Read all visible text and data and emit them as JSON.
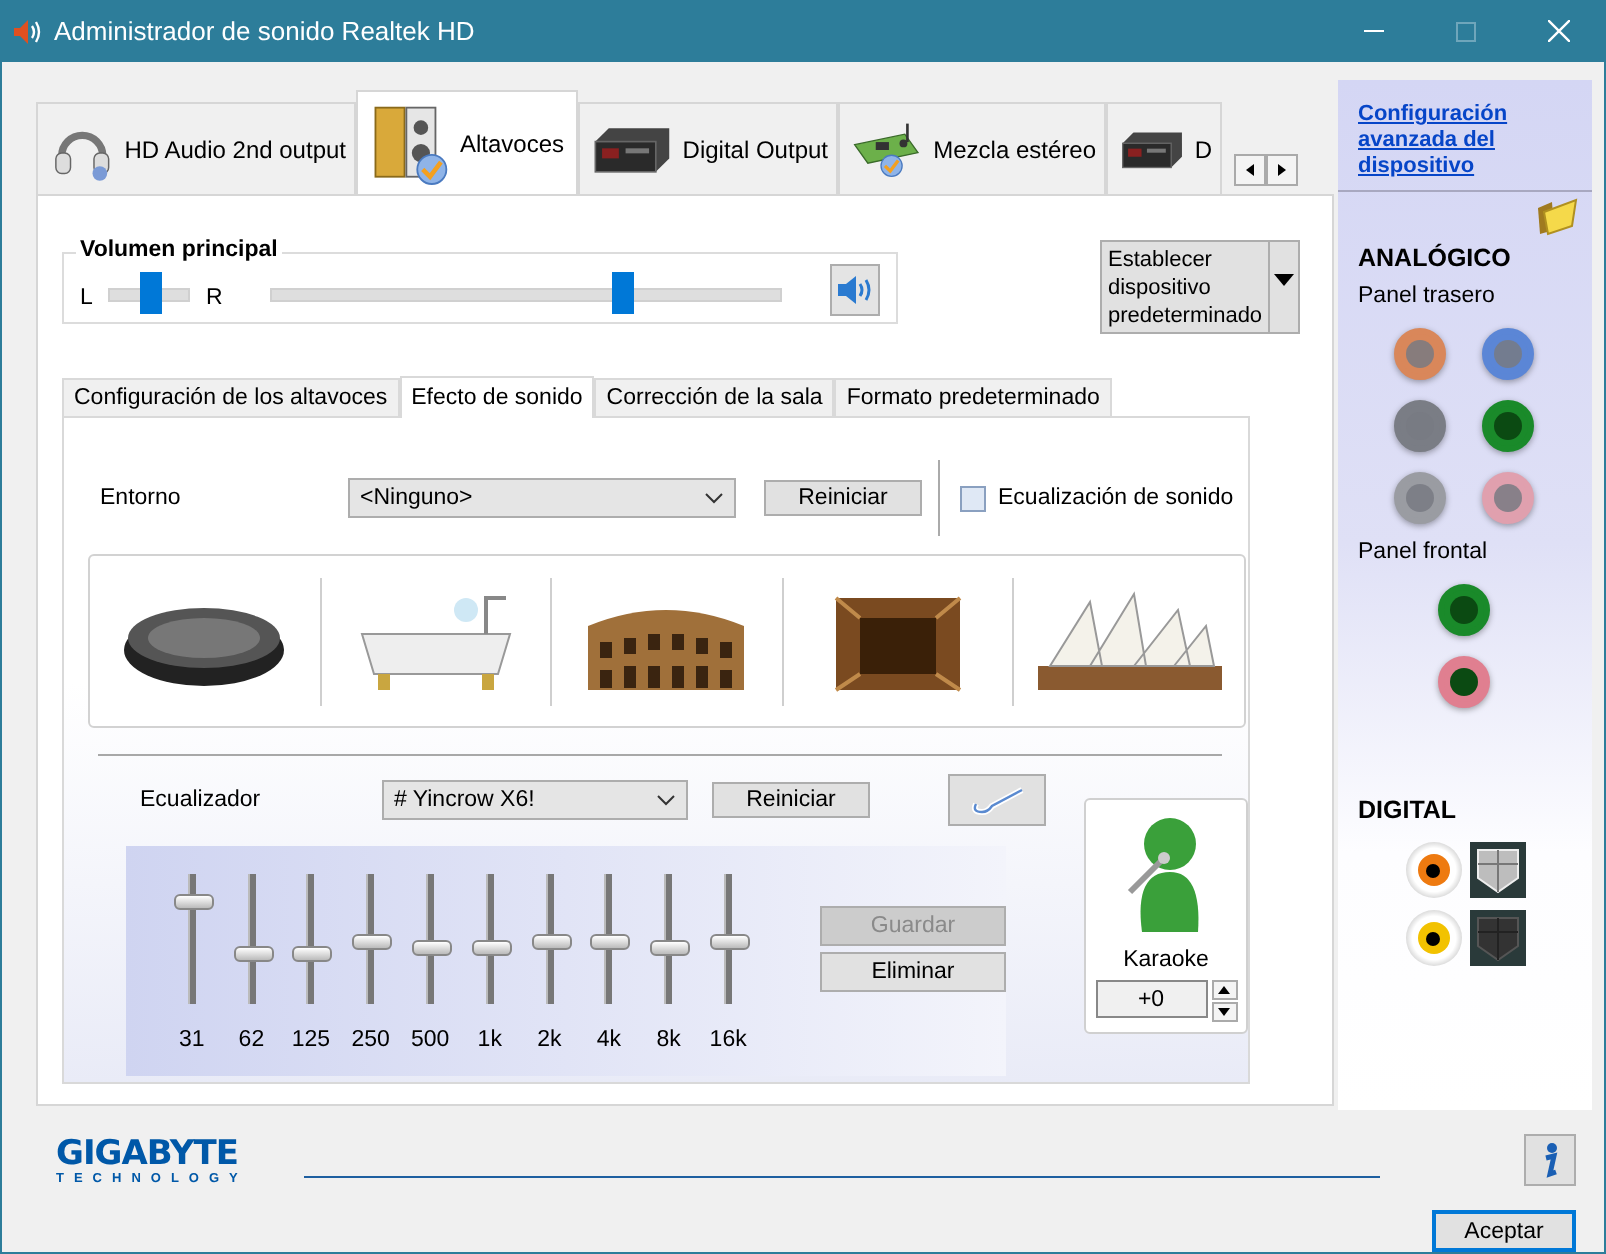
{
  "window": {
    "title": "Administrador de sonido Realtek HD"
  },
  "device_tabs": [
    {
      "label": "HD Audio 2nd output",
      "kind": "headphones",
      "selected": false
    },
    {
      "label": "Altavoces",
      "kind": "speakers",
      "selected": true
    },
    {
      "label": "Digital Output",
      "kind": "device",
      "selected": false
    },
    {
      "label": "Mezcla estéreo",
      "kind": "card",
      "selected": false
    },
    {
      "label": "D",
      "kind": "device",
      "selected": false
    }
  ],
  "master_volume": {
    "title": "Volumen principal",
    "left_label": "L",
    "right_label": "R",
    "balance": {
      "level": 0.5
    },
    "volume": {
      "level": 0.69
    }
  },
  "default_device_button": "Establecer dispositivo predeterminado",
  "sub_tabs": [
    {
      "label": "Configuración de los altavoces",
      "selected": false
    },
    {
      "label": "Efecto de sonido",
      "selected": true
    },
    {
      "label": "Corrección de la sala",
      "selected": false
    },
    {
      "label": "Formato predeterminado",
      "selected": false
    }
  ],
  "environment": {
    "label": "Entorno",
    "value": "<Ninguno>",
    "reset": "Reiniciar",
    "equalization": {
      "label": "Ecualización de sonido",
      "checked": false
    }
  },
  "equalizer": {
    "label": "Ecualizador",
    "preset": "# Yincrow X6!",
    "reset": "Reiniciar",
    "bands": [
      {
        "label": "31",
        "level": 0.8
      },
      {
        "label": "62",
        "level": 0.4
      },
      {
        "label": "125",
        "level": 0.4
      },
      {
        "label": "250",
        "level": 0.5
      },
      {
        "label": "500",
        "level": 0.45
      },
      {
        "label": "1k",
        "level": 0.45
      },
      {
        "label": "2k",
        "level": 0.5
      },
      {
        "label": "4k",
        "level": 0.5
      },
      {
        "label": "8k",
        "level": 0.45
      },
      {
        "label": "16k",
        "level": 0.5
      }
    ],
    "save": {
      "label": "Guardar",
      "disabled": true
    },
    "delete": {
      "label": "Eliminar",
      "disabled": false
    }
  },
  "karaoke": {
    "label": "Karaoke",
    "value": "+0"
  },
  "side_panel": {
    "advanced_link": "Configuración avanzada del dispositivo",
    "analog_title": "ANALÓGICO",
    "rear_title": "Panel trasero",
    "rear_jacks": [
      {
        "color": "#d9875a",
        "plugged": false
      },
      {
        "color": "#5b86d6",
        "plugged": false
      },
      {
        "color": "#7a7d85",
        "plugged": false
      },
      {
        "color": "#1a8a2a",
        "plugged": true
      },
      {
        "color": "#9a9ca2",
        "plugged": false
      },
      {
        "color": "#e0a0ae",
        "plugged": false
      }
    ],
    "front_title": "Panel frontal",
    "front_jacks": [
      {
        "color": "#1a8a2a",
        "plugged": true
      },
      {
        "color": "#e07f90",
        "plugged": true
      }
    ],
    "digital_title": "DIGITAL",
    "digital_ports": [
      {
        "color": "#ee7a10",
        "active": true
      },
      {
        "color": "#f2c200",
        "active": false
      }
    ]
  },
  "footer": {
    "brand": "GIGABYTE",
    "brand_sub": "TECHNOLOGY",
    "ok_button": "Aceptar"
  }
}
